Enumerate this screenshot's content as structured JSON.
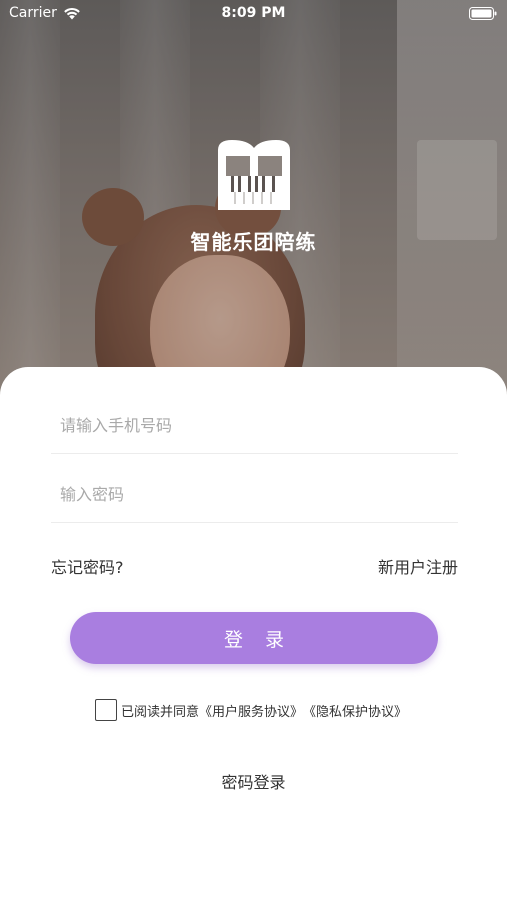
{
  "status_bar": {
    "carrier": "Carrier",
    "time": "8:09 PM"
  },
  "app": {
    "name": "智能乐团陪练"
  },
  "login_form": {
    "phone_placeholder": "请输入手机号码",
    "password_placeholder": "输入密码",
    "forgot_password": "忘记密码?",
    "register": "新用户注册",
    "login_button": "登 录",
    "agreement_prefix": "已阅读并同意",
    "user_agreement": "《用户服务协议》",
    "privacy_agreement": "《隐私保护协议》",
    "switch_mode": "密码登录"
  },
  "colors": {
    "accent": "#a97ee0",
    "text": "#333333",
    "placeholder": "#a9a9a9"
  }
}
